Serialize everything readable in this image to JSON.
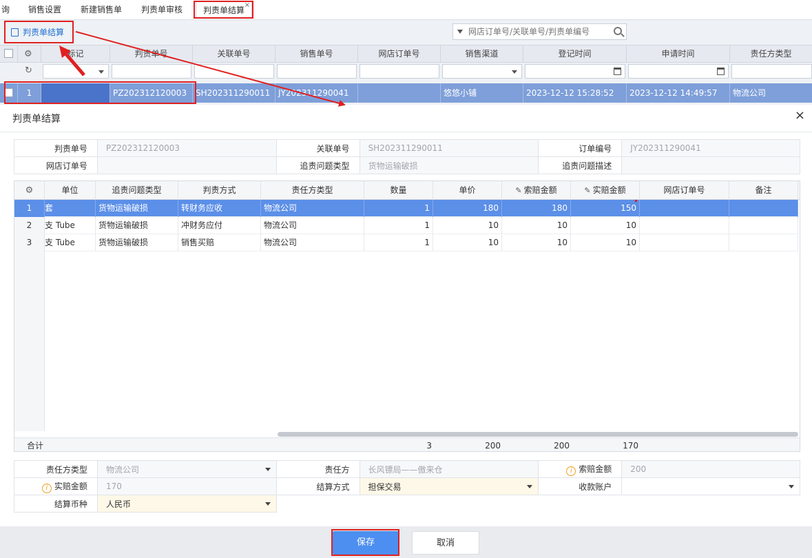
{
  "tabs": [
    {
      "label": "询"
    },
    {
      "label": "销售设置"
    },
    {
      "label": "新建销售单"
    },
    {
      "label": "判责单审核"
    },
    {
      "label": "判责单结算",
      "close": "×"
    }
  ],
  "background": {
    "toolbar_button": "判责单结算",
    "search_placeholder": "网店订单号/关联单号/判责单编号",
    "columns": [
      "标记",
      "判责单号",
      "关联单号",
      "销售单号",
      "网店订单号",
      "销售渠道",
      "登记时间",
      "申请时间",
      "责任方类型"
    ],
    "row": {
      "num": "1",
      "judgment_no": "PZ202312120003",
      "related_no": "SH202311290011",
      "sales_no": "JY202311290041",
      "shop_order": "",
      "channel": "悠悠小铺",
      "register_time": "2023-12-12 15:28:52",
      "apply_time": "2023-12-12 14:49:57",
      "party_type": "物流公司"
    }
  },
  "dialog": {
    "title": "判责单结算",
    "close": "×",
    "info": {
      "judgment_no_label": "判责单号",
      "judgment_no": "PZ202312120003",
      "related_no_label": "关联单号",
      "related_no": "SH202311290011",
      "order_no_label": "订单编号",
      "order_no": "JY202311290041",
      "shop_order_label": "网店订单号",
      "shop_order": "",
      "issue_type_label": "追责问题类型",
      "issue_type": "货物运输破损",
      "issue_desc_label": "追责问题描述",
      "issue_desc": ""
    },
    "grid": {
      "headers": [
        "单位",
        "追责问题类型",
        "判责方式",
        "责任方类型",
        "数量",
        "单价",
        "索赔金额",
        "实赔金额",
        "网店订单号",
        "备注"
      ],
      "rows": [
        {
          "num": "1",
          "unit": "套",
          "issue": "货物运输破损",
          "method": "转财务应收",
          "party": "物流公司",
          "qty": "1",
          "price": "180",
          "claim": "180",
          "actual": "150",
          "shop_order": "",
          "remark": ""
        },
        {
          "num": "2",
          "unit": "支 Tube",
          "issue": "货物运输破损",
          "method": "冲财务应付",
          "party": "物流公司",
          "qty": "1",
          "price": "10",
          "claim": "10",
          "actual": "10",
          "shop_order": "",
          "remark": ""
        },
        {
          "num": "3",
          "unit": "支 Tube",
          "issue": "货物运输破损",
          "method": "销售买赔",
          "party": "物流公司",
          "qty": "1",
          "price": "10",
          "claim": "10",
          "actual": "10",
          "shop_order": "",
          "remark": ""
        }
      ],
      "totals": {
        "label": "合计",
        "qty": "3",
        "price": "200",
        "claim": "200",
        "actual": "170"
      }
    },
    "settle": {
      "party_type_label": "责任方类型",
      "party_type": "物流公司",
      "party_label": "责任方",
      "party": "长风镖局——傲来仓",
      "claim_label": "索赔金额",
      "claim": "200",
      "actual_label": "实赔金额",
      "actual": "170",
      "method_label": "结算方式",
      "method": "担保交易",
      "account_label": "收款账户",
      "account": "",
      "currency_label": "结算币种",
      "currency": "人民币"
    },
    "buttons": {
      "save": "保存",
      "cancel": "取消"
    }
  },
  "colors": {
    "accent": "#4d8ff0",
    "annotation": "#e02020",
    "selected_row": "#5b8fe8"
  }
}
